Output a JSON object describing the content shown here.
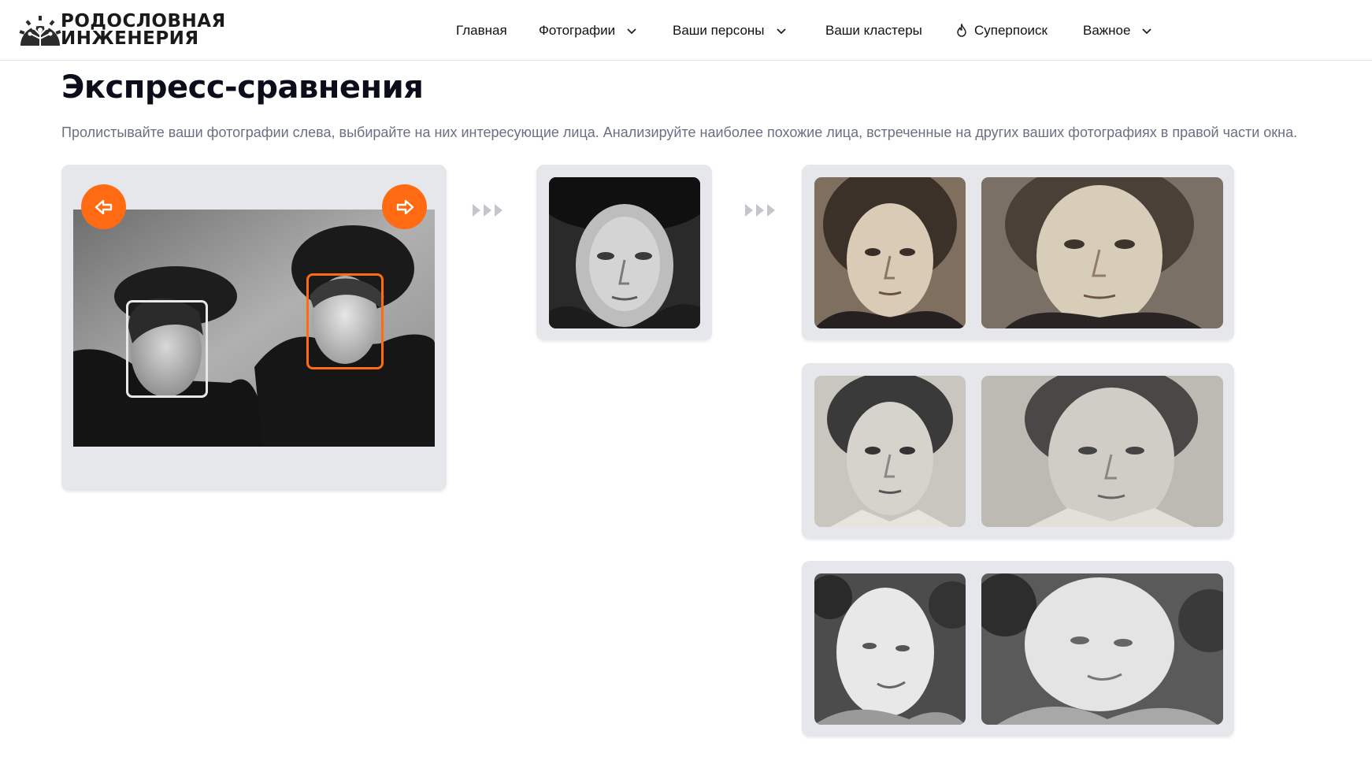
{
  "logo": {
    "line1": "РОДОСЛОВНАЯ",
    "line2": "ИНЖЕНЕРИЯ",
    "icon": "tree-gear-logo"
  },
  "nav": {
    "items": [
      {
        "label": "Главная",
        "icon": null
      },
      {
        "label": "Фотографии",
        "icon": "chevron-down-icon"
      },
      {
        "label": "Ваши персоны",
        "icon": "chevron-down-icon"
      },
      {
        "label": "Ваши кластеры",
        "icon": null
      },
      {
        "label": "Суперпоиск",
        "icon": "flame-icon"
      },
      {
        "label": "Важное",
        "icon": "chevron-down-icon"
      }
    ]
  },
  "page": {
    "title": "Экспресс-сравнения",
    "subtitle": "Пролистывайте ваши фотографии слева, выбирайте на них интересующие лица. Анализируйте наиболее похожие лица, встреченные на других ваших фотографиях в правой части окна."
  },
  "viewer": {
    "prev_icon": "arrow-left-icon",
    "next_icon": "arrow-right-icon",
    "selected_face": "right-face"
  },
  "colors": {
    "accent": "#ff6a13",
    "panel": "#e6e7eb",
    "text_muted": "#6b7081",
    "title": "#0b0d1a"
  },
  "matches": {
    "count": 3
  }
}
